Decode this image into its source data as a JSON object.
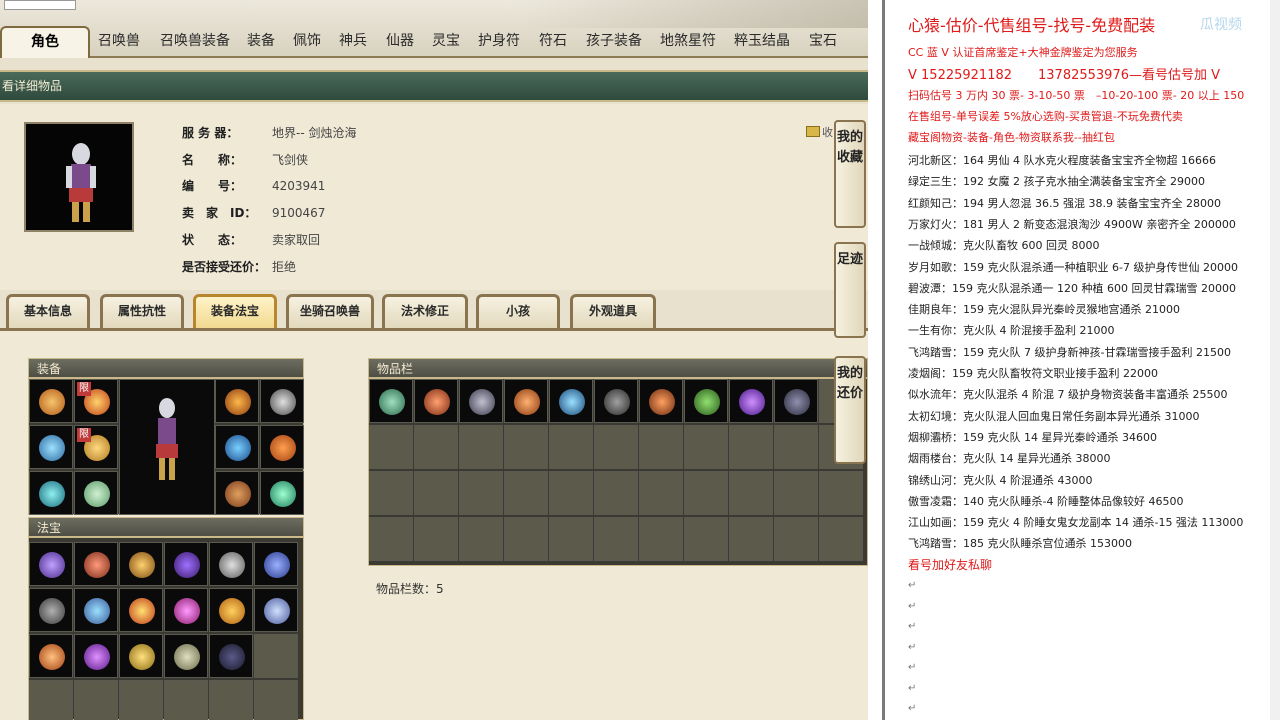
{
  "top_tabs": [
    "角色",
    "召唤兽",
    "召唤兽装备",
    "装备",
    "佩饰",
    "神兵",
    "仙器",
    "灵宝",
    "护身符",
    "符石",
    "孩子装备",
    "地煞星符",
    "粹玉结晶",
    "宝石"
  ],
  "subtitle": "看详细物品",
  "info": {
    "server_label": "服 务 器：",
    "server_value": "地界-- 剑烛沧海",
    "name_label": "名　　称：",
    "name_value": "飞剑侠",
    "id_label": "编　　号：",
    "id_value": "4203941",
    "seller_label": "卖　家　ID：",
    "seller_value": "9100467",
    "status_label": "状　　态：",
    "status_value": "卖家取回",
    "bargain_label": "是否接受还价：",
    "bargain_value": "拒绝",
    "fav_text": "收"
  },
  "sub_tabs": [
    "基本信息",
    "属性抗性",
    "装备法宝",
    "坐骑召唤兽",
    "法术修正",
    "小孩",
    "外观道具"
  ],
  "active_sub_tab": "装备法宝",
  "equip_panel": {
    "title": "装备",
    "limit_tag": "限"
  },
  "fabao_panel": {
    "title": "法宝"
  },
  "bag_panel": {
    "title": "物品栏",
    "count_text": "物品栏数：5"
  },
  "side_buttons": [
    {
      "label": "我的收藏"
    },
    {
      "label": "足迹"
    },
    {
      "label": "我的还价"
    }
  ],
  "watermark": "瓜视频",
  "right_panel": {
    "headline": "心猿-估价-代售组号-找号-免费配装",
    "lines_red": [
      "CC 蓝 V 认证首席鉴定+大神金牌鉴定为您服务",
      "V 15225921182　　13782553976—看号估号加 V",
      "扫码估号 3 万内 30 票- 3-10-50 票　–10-20-100 票- 20 以上 150",
      "在售组号-单号误差 5%放心选购-买贵管退-不玩免费代卖",
      "藏宝阁物资-装备-角色-物资联系我--抽红包"
    ],
    "lines": [
      "河北新区：164 男仙 4 队水克火程度装备宝宝齐全物超 16666",
      "绿定三生：192 女魔 2 孩子克水抽全满装备宝宝齐全 29000",
      "红颜知己：194 男人忽混 36.5 强混 38.9 装备宝宝齐全 28000",
      "万家灯火：181 男人 2 新变态混浪淘沙 4900W 亲密齐全 200000",
      "一战倾城：克火队畜牧 600 回灵 8000",
      "岁月如歌：159 克火队混杀通一种植职业 6-7 级护身传世仙 20000",
      "碧波潭：159 克火队混杀通一 120 种植 600 回灵甘霖瑞雪 20000",
      "佳期良年：159 克火混队异光秦岭灵猴地宫通杀 21000",
      "一生有你：克火队 4 阶混接手盈利 21000",
      "飞鸿踏雪：159 克火队 7 级护身新神孩-甘霖瑞雪接手盈利 21500",
      "凌烟阁：159 克火队畜牧符文职业接手盈利 22000",
      "似水流年：克火队混杀 4 阶混 7 级护身物资装备丰富通杀 25500",
      "太初幻境：克火队混人回血鬼日常任务副本异光通杀 31000",
      "烟柳灞桥：159 克火队 14 星异光秦岭通杀 34600",
      "烟雨楼台：克火队 14 星异光通杀 38000",
      "锦绣山河：克火队 4 阶混通杀 43000",
      "傲雪凌霜：140 克火队睡杀-4 阶睡整体品像较好 46500",
      "江山如画：159 克火 4 阶睡女鬼女龙副本 14 通杀-15 强法 113000",
      "飞鸿踏雪：185 克火队睡杀宫位通杀 153000"
    ],
    "footer": "看号加好友私聊"
  }
}
